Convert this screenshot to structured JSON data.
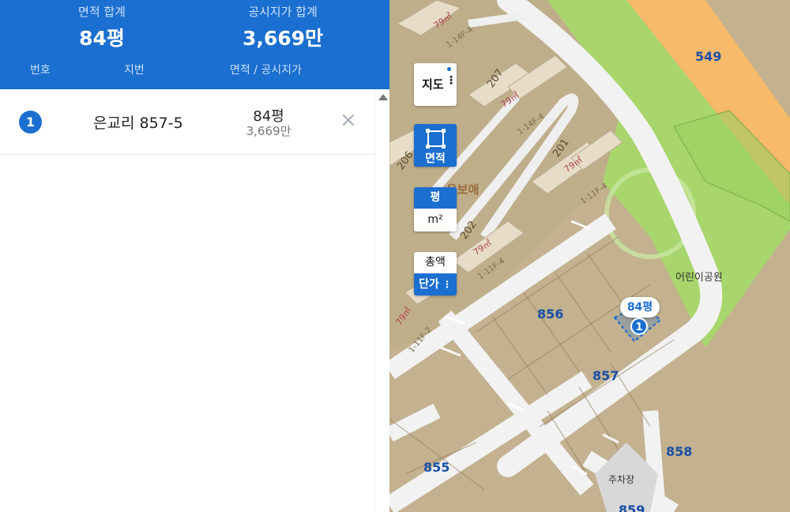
{
  "summary": {
    "area_label": "면적 합계",
    "area_value": "84평",
    "price_label": "공시지가 합계",
    "price_value": "3,669만"
  },
  "columns": {
    "number": "번호",
    "jibun": "지번",
    "area_price": "면적 / 공시지가"
  },
  "rows": [
    {
      "number": "1",
      "jibun": "은교리 857-5",
      "area": "84평",
      "price": "3,669만",
      "remove": "×"
    }
  ],
  "controls": {
    "map": "지도",
    "area": "면적",
    "unit_pyeong": "평",
    "unit_m2": "m²",
    "price_total": "총액",
    "price_unit": "단가"
  },
  "map": {
    "selected_bubble": "84평",
    "selected_marker": "1",
    "parcels": [
      "856",
      "857",
      "858",
      "855",
      "859",
      "549"
    ],
    "buildings": [
      "207",
      "201",
      "202",
      "206"
    ],
    "building_area_label": "79㎡",
    "park_label": "어린이공원",
    "parking_label": "주차장",
    "road_labels": [
      "1-14F-4",
      "1-14F-4",
      "1-11F-4",
      "1-11F-4",
      "1-11F-2"
    ],
    "district_fragment": "유보애",
    "colors": {
      "accent": "#1a6fd0",
      "park": "#a6d86a",
      "highway": "#f7b96a",
      "road": "#f4f4f4",
      "land": "#c9b998"
    }
  }
}
